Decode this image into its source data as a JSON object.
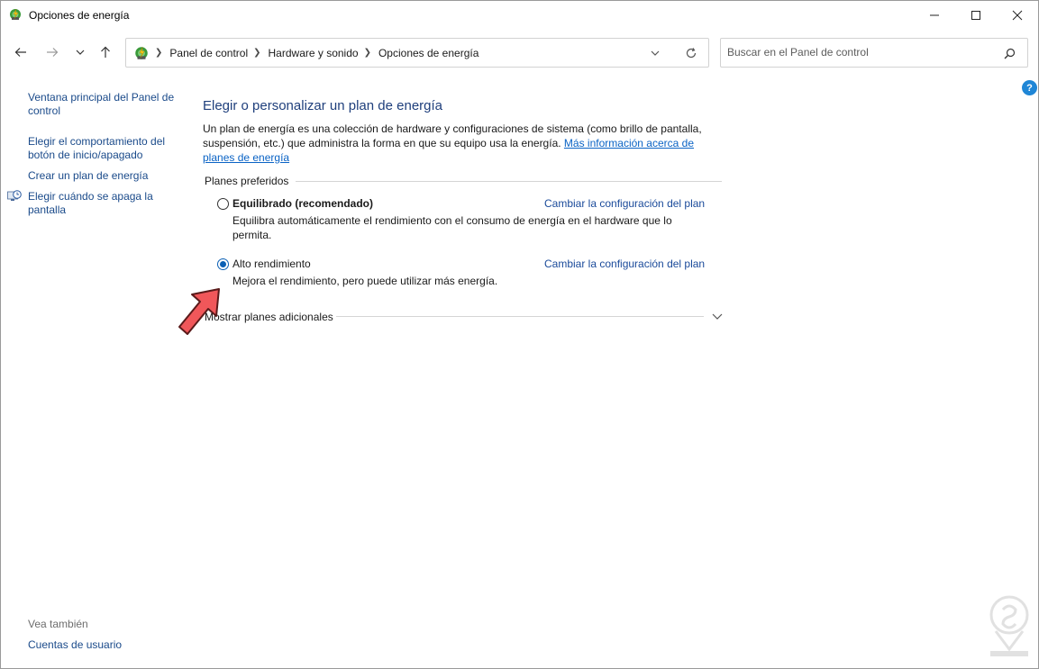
{
  "window": {
    "title": "Opciones de energía",
    "app_icon": "power-options-icon"
  },
  "nav": {
    "back_icon": "arrow-left-icon",
    "forward_icon": "arrow-right-icon",
    "recent_icon": "chevron-down-icon",
    "up_icon": "arrow-up-icon"
  },
  "address": {
    "crumbs": [
      "Panel de control",
      "Hardware y sonido",
      "Opciones de energía"
    ]
  },
  "search": {
    "placeholder": "Buscar en el Panel de control"
  },
  "help": {
    "label": "?"
  },
  "left_pane": {
    "links": [
      "Ventana principal del Panel de control",
      "Elegir el comportamiento del botón de inicio/apagado",
      "Crear un plan de energía",
      "Elegir cuándo se apaga la pantalla"
    ],
    "see_also_heading": "Vea también",
    "see_also_links": [
      "Cuentas de usuario"
    ]
  },
  "main": {
    "title": "Elegir o personalizar un plan de energía",
    "intro_text": "Un plan de energía es una colección de hardware y configuraciones de sistema (como brillo de pantalla, suspensión, etc.) que administra la forma en que su equipo usa la energía. ",
    "intro_link": "Más información acerca de planes de energía",
    "group_label": "Planes preferidos",
    "plans": [
      {
        "name": "Equilibrado (recomendado)",
        "selected": false,
        "change_link": "Cambiar la configuración del plan",
        "description": "Equilibra automáticamente el rendimiento con el consumo de energía en el hardware que lo permita."
      },
      {
        "name": "Alto rendimiento",
        "selected": true,
        "change_link": "Cambiar la configuración del plan",
        "description": "Mejora el rendimiento, pero puede utilizar más energía."
      }
    ],
    "more_plans": "Mostrar planes adicionales"
  },
  "colors": {
    "link": "#1a4a8a",
    "title": "#1f3f7c",
    "radio_selected": "#0a5fb4",
    "annotation_arrow": "#f0575a"
  }
}
